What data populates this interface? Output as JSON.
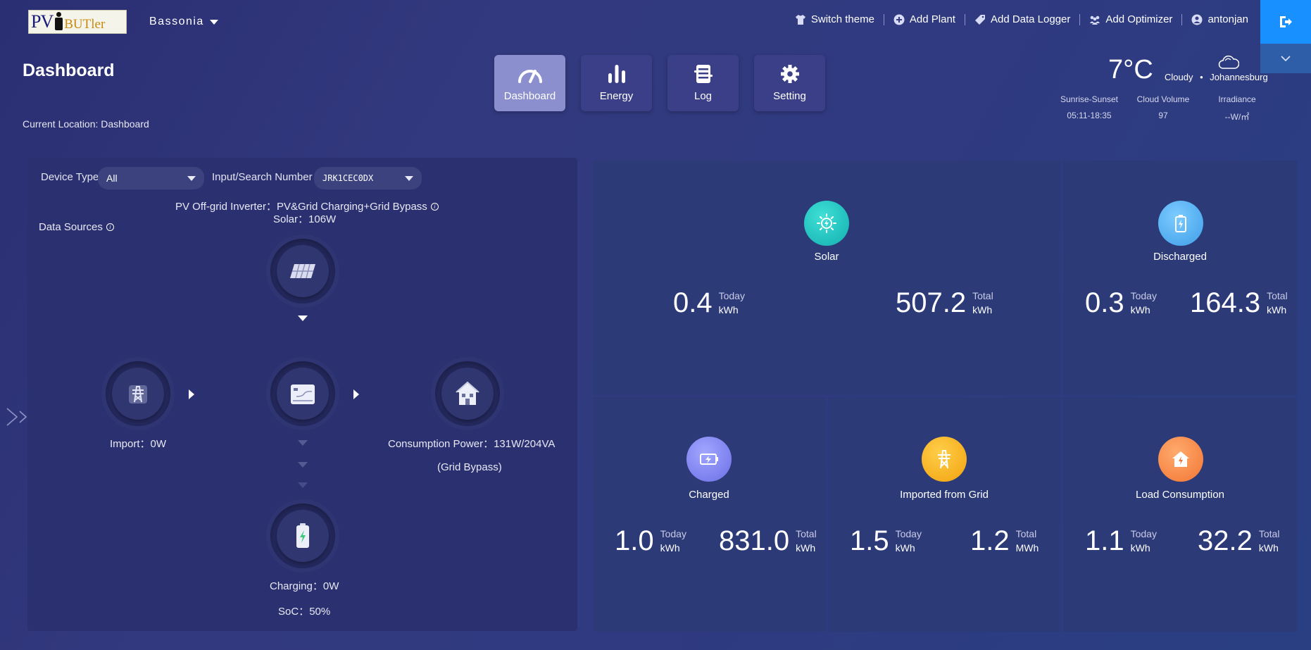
{
  "header": {
    "logo_text_pv": "PV",
    "logo_text_butler": "BUTler",
    "plant_name": "Bassonia",
    "nav": [
      {
        "label": "Switch theme",
        "icon": "shirt-icon"
      },
      {
        "label": "Add Plant",
        "icon": "plus-circle-icon"
      },
      {
        "label": "Add Data Logger",
        "icon": "tag-icon"
      },
      {
        "label": "Add Optimizer",
        "icon": "group-icon"
      },
      {
        "label": "antonjan",
        "icon": "user-icon"
      }
    ]
  },
  "page": {
    "title": "Dashboard",
    "location": "Current Location: Dashboard"
  },
  "tabs": [
    {
      "label": "Dashboard",
      "icon": "gauge-icon",
      "active": true
    },
    {
      "label": "Energy",
      "icon": "bar-chart-icon",
      "active": false
    },
    {
      "label": "Log",
      "icon": "log-icon",
      "active": false
    },
    {
      "label": "Setting",
      "icon": "gear-icon",
      "active": false
    }
  ],
  "weather": {
    "temperature": "7°C",
    "condition": "Cloudy",
    "dot": "•",
    "city": "Johannesburg",
    "stats": [
      {
        "label": "Sunrise-Sunset",
        "value": "05:11-18:35"
      },
      {
        "label": "Cloud Volume",
        "value": "97"
      },
      {
        "label": "Irradiance",
        "value": "--W/㎡"
      }
    ]
  },
  "filters": {
    "device_type_label": "Device Type",
    "device_type_value": "All",
    "search_label": "Input/Search Number",
    "search_value": "JRK1CEC0DX"
  },
  "flow": {
    "inverter_label": "PV Off-grid Inverter：",
    "inverter_mode": "PV&Grid Charging+Grid Bypass",
    "solar_label": "Solar：",
    "solar_value": "106W",
    "data_sources": "Data Sources",
    "import_label": "Import：",
    "import_value": "0W",
    "consumption_label": "Consumption Power：",
    "consumption_value": "131W/204VA",
    "grid_bypass": "(Grid Bypass)",
    "charging_label": "Charging：",
    "charging_value": "0W",
    "soc_label": "SoC：",
    "soc_value": "50%"
  },
  "stats": {
    "solar": {
      "title": "Solar",
      "today_value": "0.4",
      "today_label": "Today",
      "today_unit": "kWh",
      "total_value": "507.2",
      "total_label": "Total",
      "total_unit": "kWh",
      "color": "#1ec6c0"
    },
    "discharged": {
      "title": "Discharged",
      "today_value": "0.3",
      "today_label": "Today",
      "today_unit": "kWh",
      "total_value": "164.3",
      "total_label": "Total",
      "total_unit": "kWh",
      "color": "#4fb2f3"
    },
    "charged": {
      "title": "Charged",
      "today_value": "1.0",
      "today_label": "Today",
      "today_unit": "kWh",
      "total_value": "831.0",
      "total_label": "Total",
      "total_unit": "kWh",
      "color": "#7b7ff0"
    },
    "imported": {
      "title": "Imported from Grid",
      "today_value": "1.5",
      "today_label": "Today",
      "today_unit": "kWh",
      "total_value": "1.2",
      "total_label": "Total",
      "total_unit": "MWh",
      "color": "#f5b21e"
    },
    "load": {
      "title": "Load Consumption",
      "today_value": "1.1",
      "today_label": "Today",
      "today_unit": "kWh",
      "total_value": "32.2",
      "total_label": "Total",
      "total_unit": "kWh",
      "color": "#f98a4a"
    }
  }
}
